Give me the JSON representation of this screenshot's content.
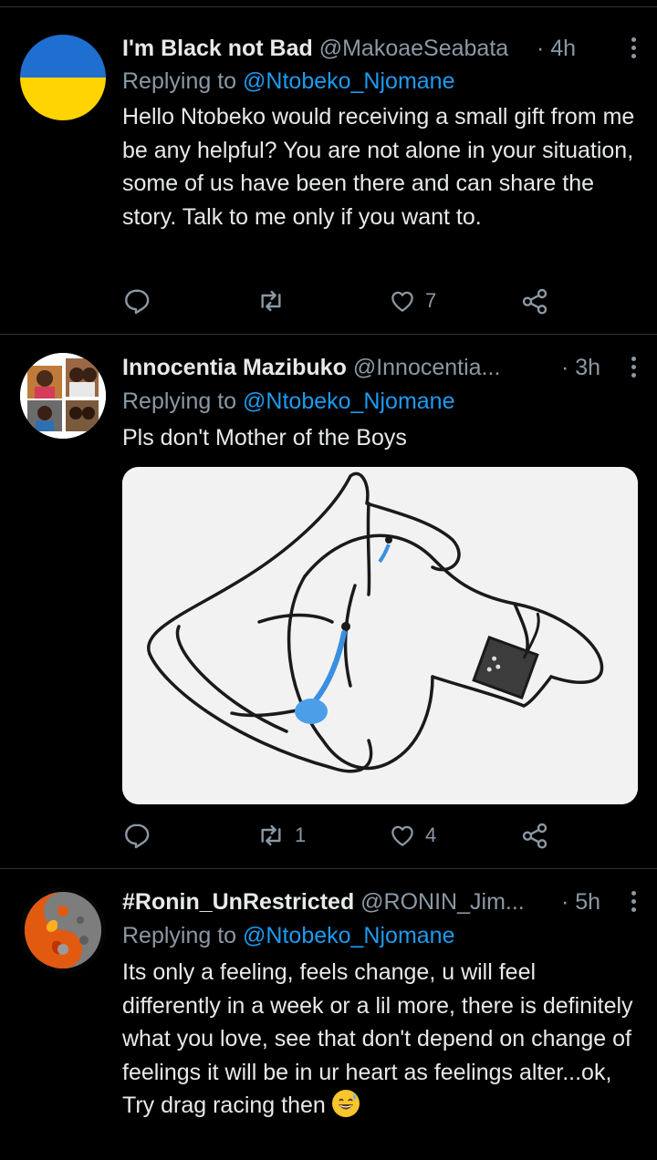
{
  "tweets": [
    {
      "name": "I'm Black not Bad",
      "handle": "@MakoaeSeabata",
      "time": "· 4h",
      "replying_prefix": "Replying to ",
      "replying_to": "@Ntobeko_Njomane",
      "text": "Hello Ntobeko would receiving a small gift from me be any helpful? You are not alone in your situation, some of us have been there and can share the story. Talk to me only if you want to.",
      "retweets": "",
      "likes": "7"
    },
    {
      "name": "Innocentia Mazibuko",
      "handle": "@Innocentia...",
      "time": "· 3h",
      "replying_prefix": "Replying to ",
      "replying_to": "@Ntobeko_Njomane",
      "text": "Pls don't Mother of the Boys",
      "retweets": "1",
      "likes": "4"
    },
    {
      "name": "#Ronin_UnRestricted",
      "handle": "@RONIN_Jim...",
      "time": "· 5h",
      "replying_prefix": "Replying to ",
      "replying_to": "@Ntobeko_Njomane",
      "text": "Its only a feeling, feels change, u will feel differently in a week or a lil more, there is definitely what you love, see that don't depend on change of feelings it will be in ur heart as feelings alter...ok, Try drag racing then"
    }
  ],
  "icons": {
    "reply": "reply-icon",
    "retweet": "retweet-icon",
    "like": "heart-icon",
    "share": "share-icon",
    "more": "more-icon"
  },
  "colors": {
    "background": "#000000",
    "text": "#e7e9ea",
    "secondary": "#8b98a5",
    "mention": "#1d9bf0",
    "divider": "#2f3336"
  }
}
